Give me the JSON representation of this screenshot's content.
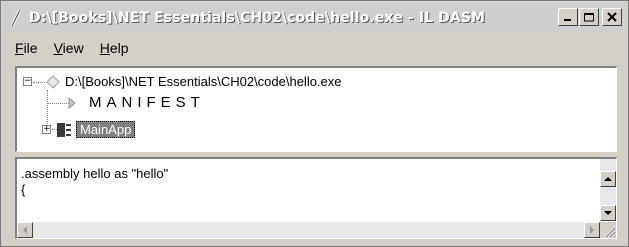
{
  "window": {
    "title": "D:\\[Books]\\NET Essentials\\CH02\\code\\hello.exe - IL DASM",
    "buttons": {
      "minimize": "_",
      "maximize": "□",
      "close": "X"
    }
  },
  "menu": {
    "items": [
      {
        "label_first": "F",
        "label_rest": "ile"
      },
      {
        "label_first": "V",
        "label_rest": "iew"
      },
      {
        "label_first": "H",
        "label_rest": "elp"
      }
    ]
  },
  "tree": {
    "root": {
      "expander": "−",
      "label": "D:\\[Books]\\NET Essentials\\CH02\\code\\hello.exe",
      "icon": "diamond-icon"
    },
    "manifest": {
      "label": "MANIFEST",
      "icon": "triangle-right-icon"
    },
    "mainapp": {
      "expander": "+",
      "label": "MainApp",
      "icon": "class-icon"
    }
  },
  "code": {
    "lines": [
      ".assembly hello as \"hello\"",
      "{"
    ]
  },
  "icons": {
    "title": "pen-icon",
    "scroll_up": "arrow-up-icon",
    "scroll_down": "arrow-down-icon",
    "scroll_left": "arrow-left-icon",
    "scroll_right": "arrow-right-icon",
    "resize": "resize-grip-icon"
  }
}
